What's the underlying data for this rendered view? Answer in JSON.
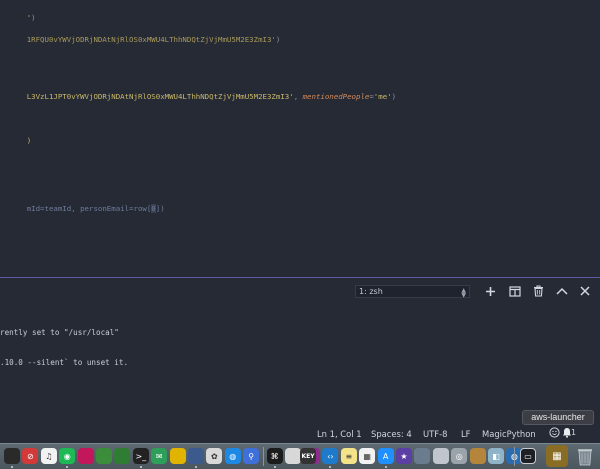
{
  "editor": {
    "lines": [
      {
        "parts": [
          {
            "t": "'",
            "c": "str"
          },
          {
            "t": ")",
            "c": "punc"
          }
        ]
      },
      {
        "parts": [
          {
            "t": "1RFQU0vYWVjODRjNDAtNjRlOS0xMWU4LThhNDQtZjVjMmU5M2E3ZmI3'",
            "c": "str-dim"
          },
          {
            "t": ")",
            "c": "punc"
          }
        ]
      },
      {
        "parts": [
          {
            "t": "L3VzL1JPT0vYWVjODRjNDAtNjRlOS0xMWU4LThhNDQtZjVjMmU5M2E3ZmI3'",
            "c": "str"
          },
          {
            "t": ", ",
            "c": "punc"
          },
          {
            "t": "mentionedPeople",
            "c": "param"
          },
          {
            "t": "=",
            "c": "punc"
          },
          {
            "t": "'me'",
            "c": "str"
          },
          {
            "t": ")",
            "c": "punc"
          }
        ]
      },
      {
        "parts": [
          {
            "t": ")",
            "c": "str"
          }
        ]
      },
      {
        "parts": [
          {
            "t": "mId=teamId, personEmail=row[",
            "c": "ident"
          },
          {
            "t": "0",
            "c": "ident"
          },
          {
            "t": "])",
            "c": "ident"
          }
        ]
      }
    ]
  },
  "terminal": {
    "select_value": "1: zsh",
    "output": [
      "rently set to \"/usr/local\"",
      ".10.0 --silent` to unset it."
    ],
    "icons": [
      "plus-icon",
      "split-icon",
      "trash-icon",
      "chevron-up-icon",
      "close-icon"
    ]
  },
  "statusbar": {
    "position": "Ln 1, Col 1",
    "spaces": "Spaces: 4",
    "encoding": "UTF-8",
    "eol": "LF",
    "language": "MagicPython",
    "notifications": "1"
  },
  "tooltip": {
    "text": "aws-launcher"
  },
  "dock": {
    "key_label": "KEY",
    "icons": [
      {
        "name": "app-icon",
        "bg": "#2a2a2a"
      },
      {
        "name": "no-entry-icon",
        "bg": "#d23a3a"
      },
      {
        "name": "music-icon",
        "bg": "#f2f2f2"
      },
      {
        "name": "spotify-icon",
        "bg": "#1db954"
      },
      {
        "name": "app-icon",
        "bg": "#c2185b"
      },
      {
        "name": "app-icon",
        "bg": "#3b8d3b"
      },
      {
        "name": "app-icon",
        "bg": "#2e7d32"
      },
      {
        "name": "terminal-icon",
        "bg": "#222"
      },
      {
        "name": "chat-icon",
        "bg": "#2e9e5b"
      },
      {
        "name": "app-icon",
        "bg": "#e0b400"
      },
      {
        "name": "app-icon",
        "bg": "#3c5a8c"
      },
      {
        "name": "photos-icon",
        "bg": "#d9d9d9"
      },
      {
        "name": "globe-icon",
        "bg": "#1e88e5"
      },
      {
        "name": "maps-icon",
        "bg": "#3f6fd8"
      },
      {
        "name": "console-icon",
        "bg": "#1c1c1c"
      },
      {
        "name": "keychain-icon",
        "bg": "#d8d8d8"
      },
      {
        "name": "app-icon",
        "bg": "#8e2c8e"
      },
      {
        "name": "vscode-icon",
        "bg": "#1f7acc"
      },
      {
        "name": "notes-icon",
        "bg": "#f5e38a"
      },
      {
        "name": "calendar-icon",
        "bg": "#f2f2f2"
      },
      {
        "name": "app-store-icon",
        "bg": "#1e90ff"
      },
      {
        "name": "star-icon",
        "bg": "#5b3fa5"
      },
      {
        "name": "app-icon",
        "bg": "#6b7c8f"
      },
      {
        "name": "app-icon",
        "bg": "#c0c6cc"
      },
      {
        "name": "disk-icon",
        "bg": "#9aa2aa"
      },
      {
        "name": "app-icon",
        "bg": "#b5853c"
      },
      {
        "name": "preview-icon",
        "bg": "#8fb3c9"
      },
      {
        "name": "globe-icon",
        "bg": "#2b6cb0"
      }
    ]
  }
}
